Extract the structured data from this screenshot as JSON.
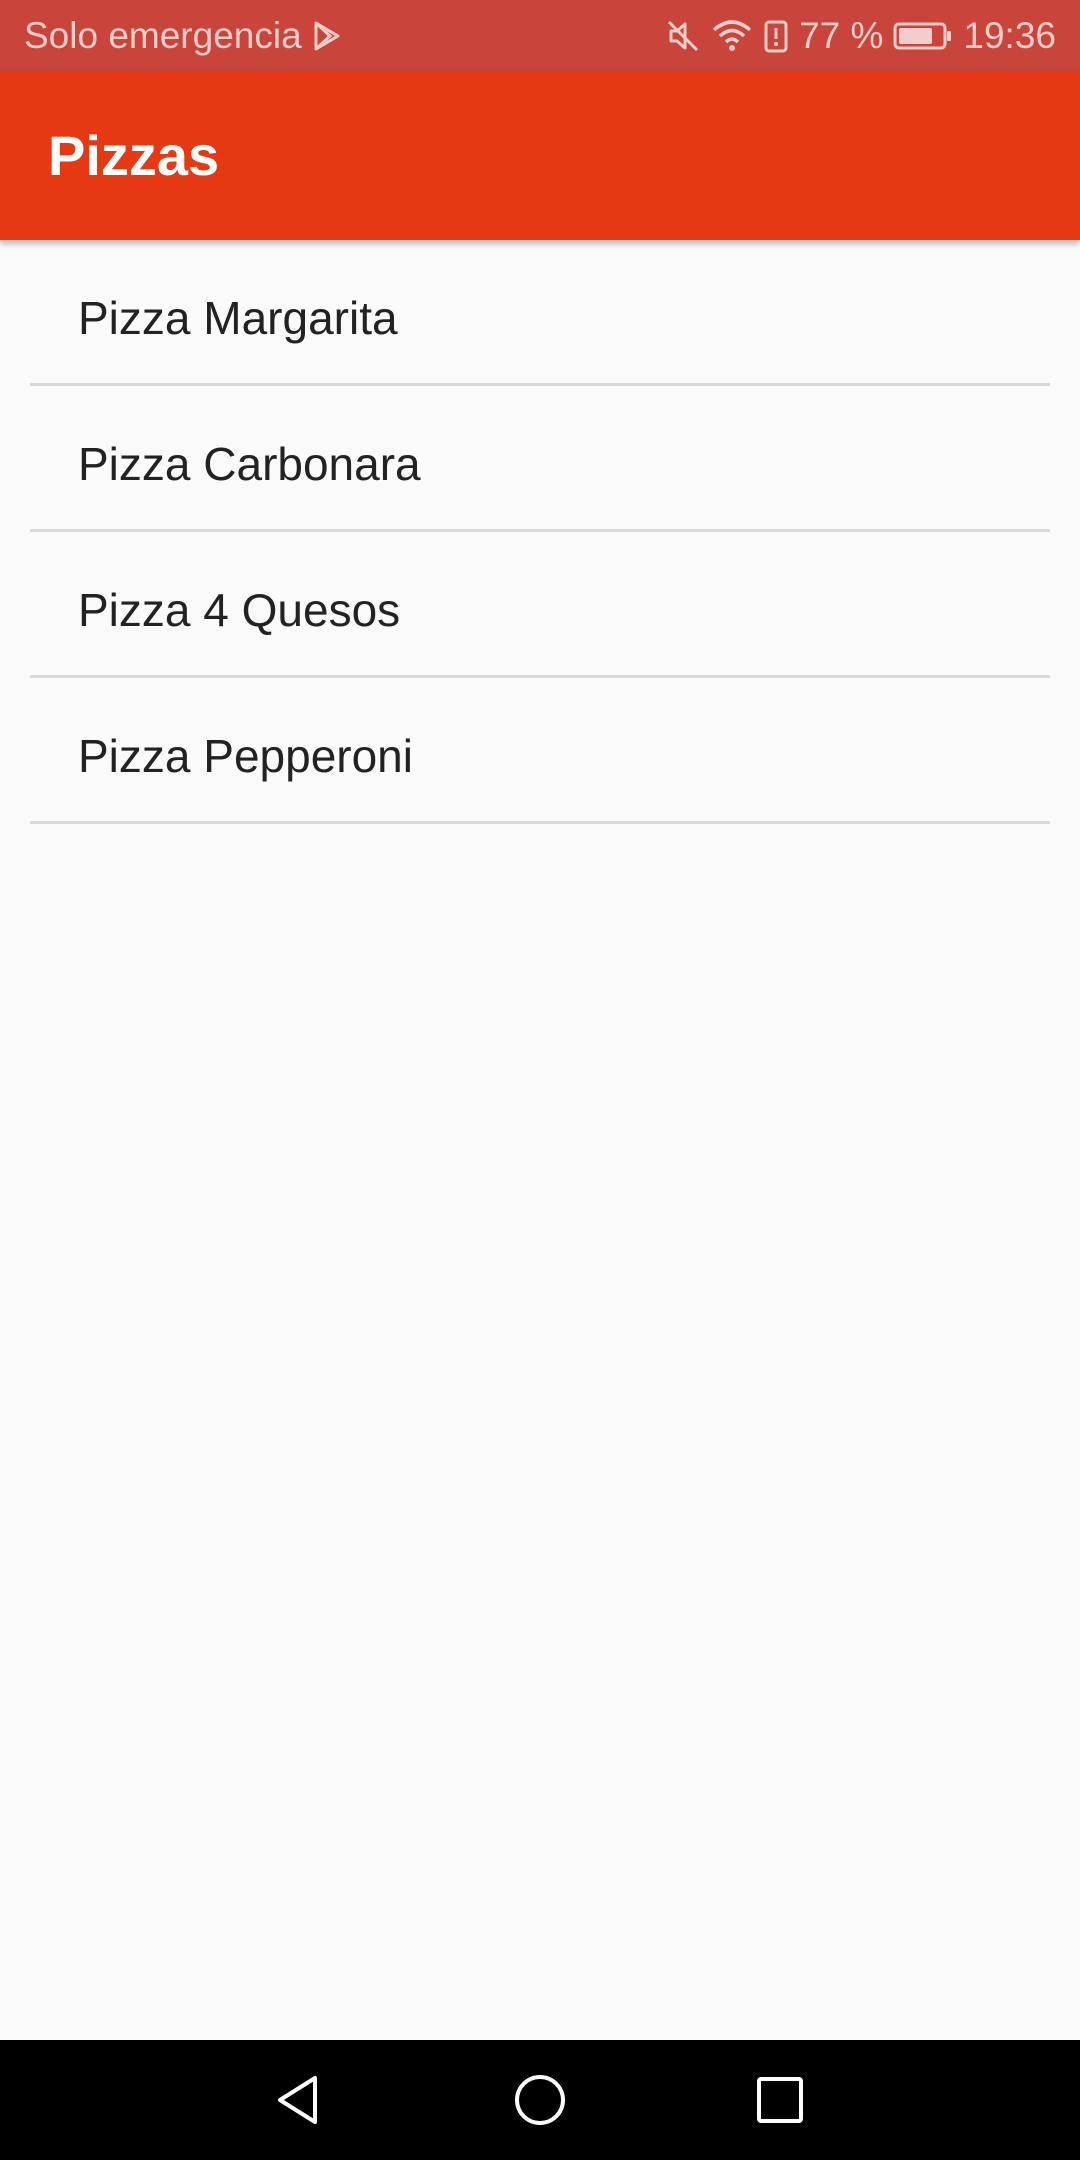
{
  "status_bar": {
    "carrier": "Solo emergencia",
    "battery_percent": "77 %",
    "time": "19:36",
    "icons": [
      "play-store-icon",
      "mute-icon",
      "wifi-icon",
      "battery-alert-icon",
      "battery-icon"
    ]
  },
  "app_bar": {
    "title": "Pizzas",
    "color": "#e63812"
  },
  "pizzas": {
    "items": [
      {
        "label": "Pizza Margarita"
      },
      {
        "label": "Pizza Carbonara"
      },
      {
        "label": "Pizza 4 Quesos"
      },
      {
        "label": "Pizza Pepperoni"
      }
    ]
  },
  "nav_bar": {
    "buttons": [
      "back-icon",
      "home-icon",
      "recents-icon"
    ]
  }
}
